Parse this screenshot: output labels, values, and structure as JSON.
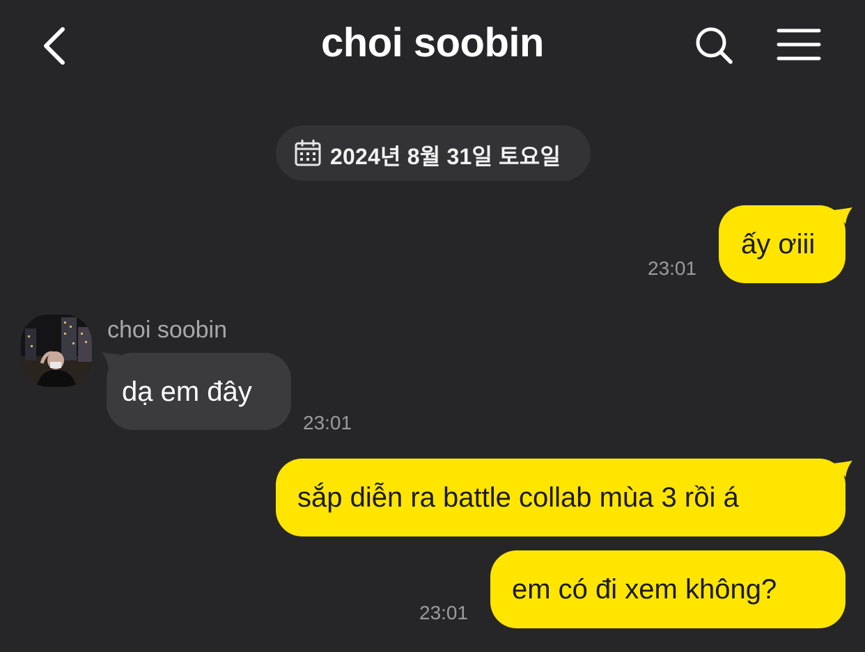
{
  "header": {
    "title": "choi soobin",
    "back_icon": "chevron-left-icon",
    "search_icon": "search-icon",
    "menu_icon": "hamburger-menu-icon"
  },
  "date_divider": {
    "icon": "calendar-icon",
    "text": "2024년 8월 31일 토요일"
  },
  "colors": {
    "background": "#262628",
    "my_bubble": "#ffe500",
    "their_bubble": "#3b3b3d",
    "timestamp": "#9b9b9b"
  },
  "messages": [
    {
      "from": "me",
      "text": "ấy ơiii",
      "time": "23:01"
    },
    {
      "from": "choi soobin",
      "sender_name": "choi soobin",
      "text": "dạ em đây",
      "time": "23:01"
    },
    {
      "from": "me",
      "text": "sắp diễn ra battle collab mùa 3 rồi á",
      "time": ""
    },
    {
      "from": "me",
      "text": "em có đi xem không?",
      "time": "23:01"
    }
  ]
}
